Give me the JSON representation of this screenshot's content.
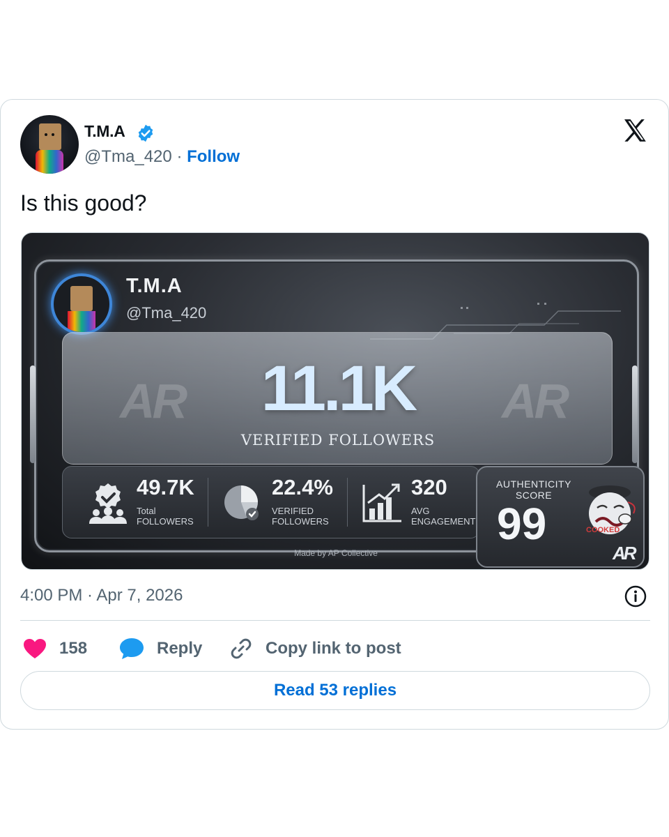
{
  "tweet": {
    "author": {
      "display_name": "T.M.A",
      "handle": "@Tma_420",
      "separator": "·",
      "follow_label": "Follow"
    },
    "text": "Is this good?",
    "timestamp": "4:00 PM · Apr 7, 2026",
    "media": {
      "card_name": "T.M.A",
      "card_handle": "@Tma_420",
      "watermark": "AR",
      "headline_value": "11.1K",
      "headline_label": "VERIFIED FOLLOWERS",
      "stats": [
        {
          "value": "49.7K",
          "label_line1": "Total",
          "label_line2": "FOLLOWERS",
          "icon": "followers-group-icon"
        },
        {
          "value": "22.4%",
          "label_line1": "VERIFIED",
          "label_line2": "FOLLOWERS",
          "icon": "pie-check-icon"
        },
        {
          "value": "320",
          "label_line1": "AVG",
          "label_line2": "ENGAGEMENT",
          "icon": "bar-growth-icon"
        }
      ],
      "authenticity_label_line1": "AUTHENTICITY",
      "authenticity_label_line2": "SCORE",
      "authenticity_score": "99",
      "mascot_caption": "COOKED",
      "credit": "Made by AP Collective",
      "corner_logo": "AR"
    },
    "actions": {
      "like_count": "158",
      "reply_label": "Reply",
      "copy_label": "Copy link to post"
    },
    "read_replies_label": "Read 53 replies"
  },
  "colors": {
    "verified": "#1d9bf0",
    "link": "#006fd6",
    "like": "#f91880",
    "reply": "#1d9bf0",
    "muted": "#536471"
  }
}
